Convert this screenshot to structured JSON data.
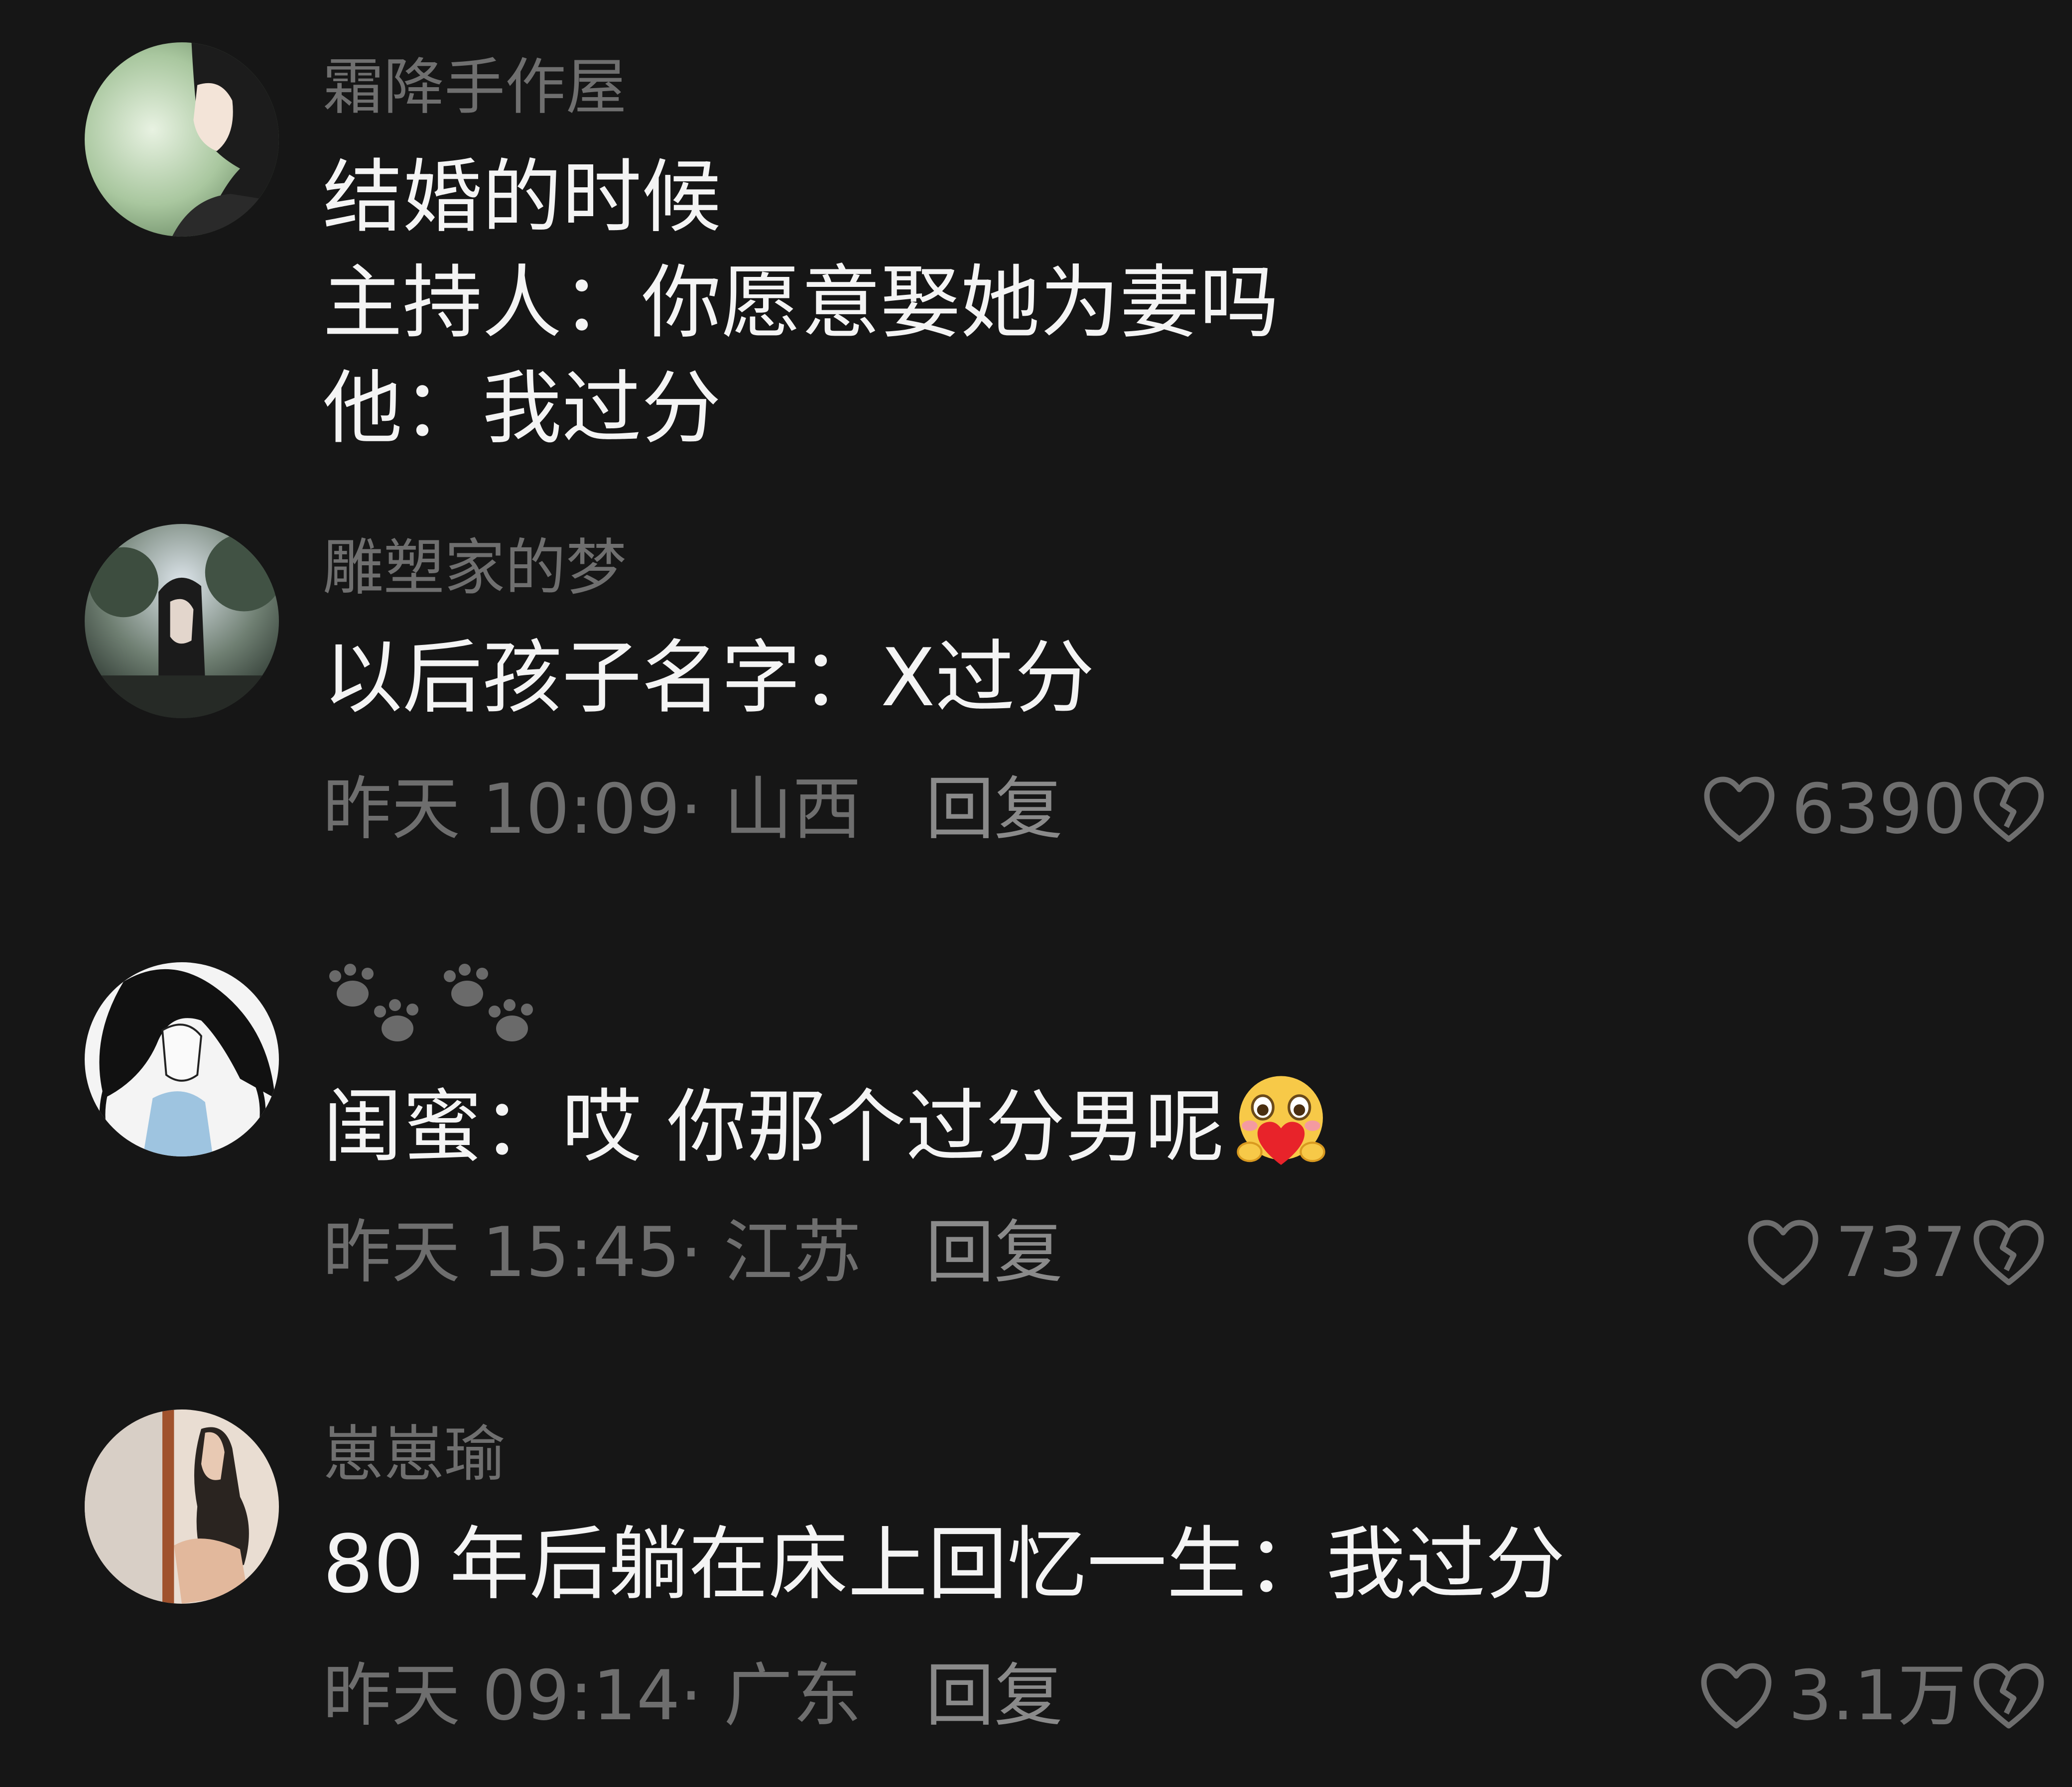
{
  "comments": [
    {
      "username": "霜降手作屋",
      "lines": [
        "结婚的时候",
        "主持人：你愿意娶她为妻吗",
        "他：我过分"
      ]
    },
    {
      "username": "雕塑家的梦",
      "lines": [
        "以后孩子名字：X过分"
      ],
      "time": "昨天 10:09· 山西",
      "reply": "回复",
      "likes": "6390"
    },
    {
      "username": "",
      "username_icon": "paw-prints-icon",
      "lines": [
        "闺蜜：哎 你那个过分男呢"
      ],
      "emoji": "blushing-heart-emoji",
      "time": "昨天 15:45· 江苏",
      "reply": "回复",
      "likes": "737"
    },
    {
      "username": "崽崽瑜",
      "lines": [
        "80 年后躺在床上回忆一生：我过分"
      ],
      "time": "昨天 09:14· 广东",
      "reply": "回复",
      "likes": "3.1万"
    }
  ],
  "colors": {
    "background": "#161616",
    "username": "#6f6f6f",
    "body_text": "#f4f4f4",
    "meta_text": "#6e6e6e"
  }
}
